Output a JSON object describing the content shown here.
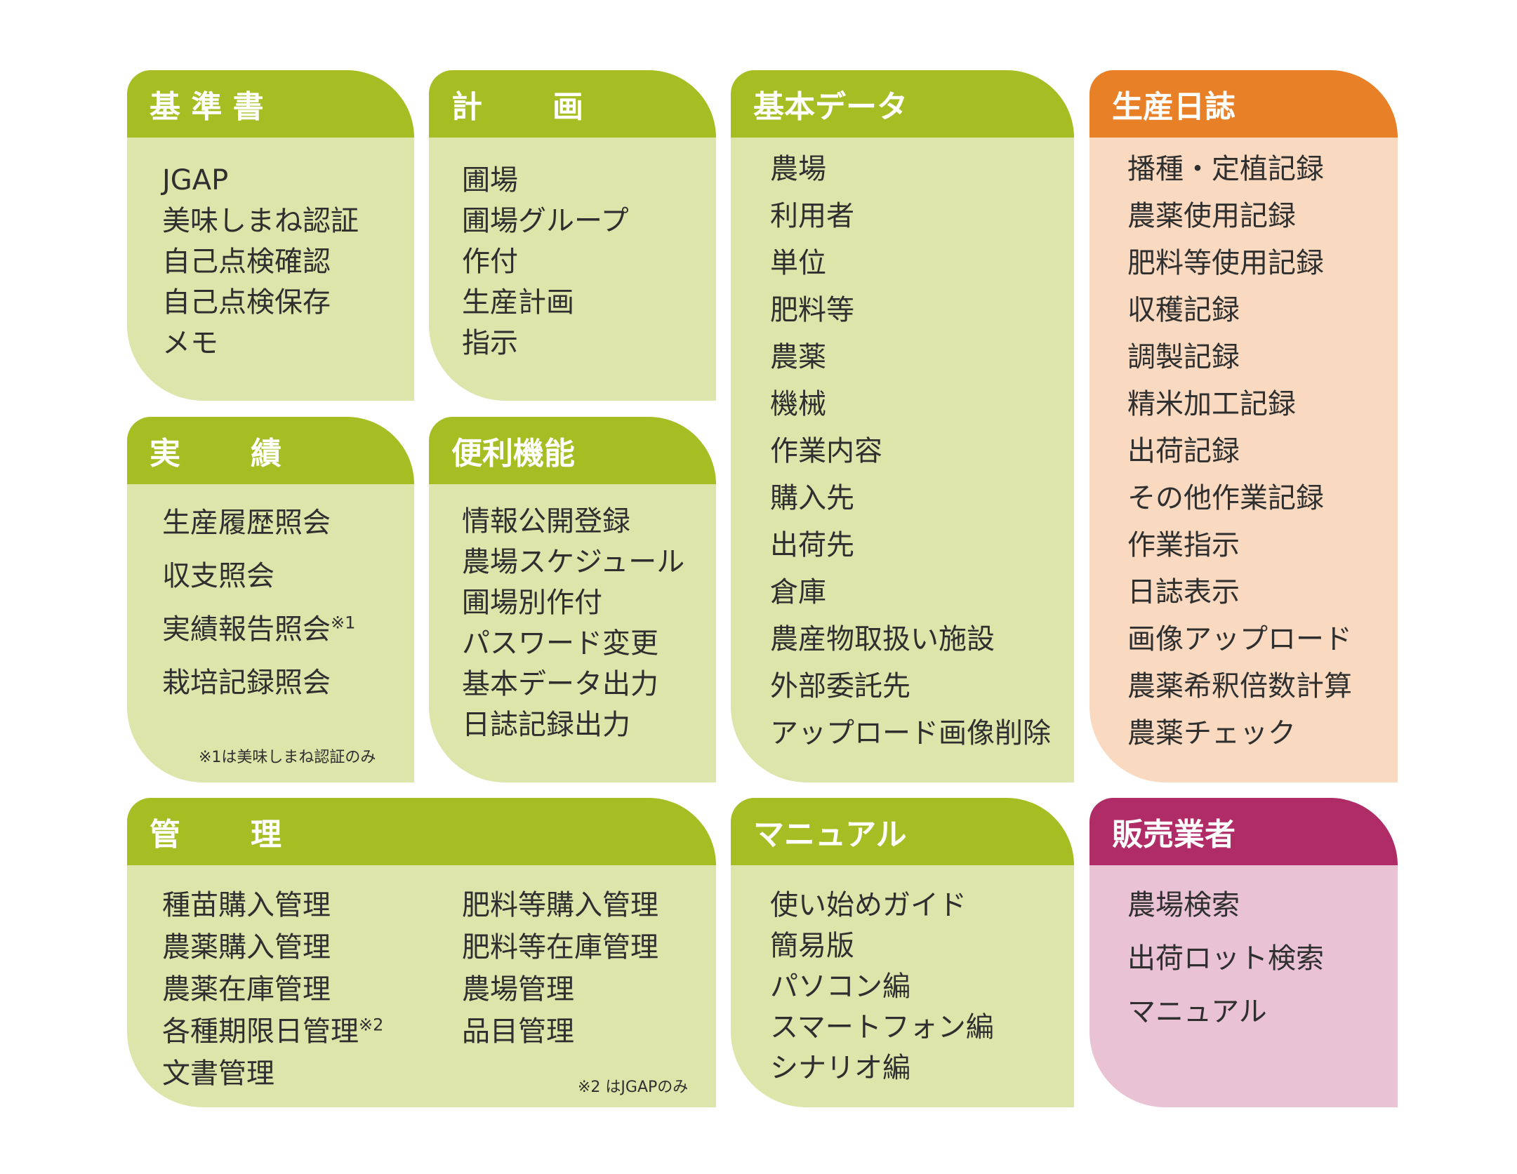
{
  "colors": {
    "green_header": "#a6bd23",
    "green_body": "#dde5ab",
    "orange_header": "#e88027",
    "orange_body": "#f9d9bf",
    "magenta_header": "#b02c66",
    "magenta_body": "#e9c2d3"
  },
  "panels": {
    "kijunsho": {
      "title": "基 準 書",
      "items": [
        "JGAP",
        "美味しまね認証",
        "自己点検確認",
        "自己点検保存",
        "メモ"
      ]
    },
    "keikaku": {
      "title_1": "計",
      "title_2": "画",
      "items": [
        "圃場",
        "圃場グループ",
        "作付",
        "生産計画",
        "指示"
      ]
    },
    "kihon_data": {
      "title": "基本データ",
      "items": [
        "農場",
        "利用者",
        "単位",
        "肥料等",
        "農薬",
        "機械",
        "作業内容",
        "購入先",
        "出荷先",
        "倉庫",
        "農産物取扱い施設",
        "外部委託先",
        "アップロード画像削除"
      ]
    },
    "seisan_nisshi": {
      "title": "生産日誌",
      "items": [
        "播種・定植記録",
        "農薬使用記録",
        "肥料等使用記録",
        "収穫記録",
        "調製記録",
        "精米加工記録",
        "出荷記録",
        "その他作業記録",
        "作業指示",
        "日誌表示",
        "画像アップロード",
        "農薬希釈倍数計算",
        "農薬チェック"
      ]
    },
    "jisseki": {
      "title_1": "実",
      "title_2": "績",
      "items": [
        "生産履歴照会",
        "収支照会",
        "実績報告照会",
        "栽培記録照会"
      ],
      "item_mark": "※1",
      "note": "※1は美味しまね認証のみ"
    },
    "benri_kinou": {
      "title": "便利機能",
      "items": [
        "情報公開登録",
        "農場スケジュール",
        "圃場別作付",
        "パスワード変更",
        "基本データ出力",
        "日誌記録出力"
      ]
    },
    "kanri": {
      "title_1": "管",
      "title_2": "理",
      "items_left": [
        "種苗購入管理",
        "農薬購入管理",
        "農薬在庫管理",
        "各種期限日管理",
        "文書管理"
      ],
      "items_right": [
        "肥料等購入管理",
        "肥料等在庫管理",
        "農場管理",
        "品目管理"
      ],
      "item_mark": "※2",
      "note": "※2 はJGAPのみ"
    },
    "manual": {
      "title": "マニュアル",
      "items": [
        "使い始めガイド",
        "簡易版",
        "パソコン編",
        "スマートフォン編",
        "シナリオ編"
      ]
    },
    "hanbai_gyousha": {
      "title": "販売業者",
      "items": [
        "農場検索",
        "出荷ロット検索",
        "マニュアル"
      ]
    }
  }
}
